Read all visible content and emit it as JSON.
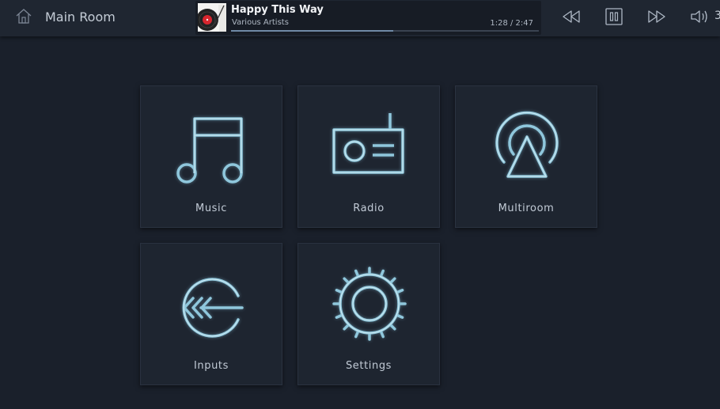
{
  "header": {
    "room_title": "Main Room",
    "volume": "3"
  },
  "now_playing": {
    "title": "Happy This Way",
    "artist": "Various Artists",
    "time": "1:28 / 2:47",
    "progress": 0.527
  },
  "controls": {
    "icons": [
      "home-icon",
      "rewind-icon",
      "pause-icon",
      "fast-forward-icon",
      "volume-icon"
    ]
  },
  "tiles": [
    {
      "label": "Music",
      "icon": "music-note-icon"
    },
    {
      "label": "Radio",
      "icon": "radio-icon"
    },
    {
      "label": "Multiroom",
      "icon": "multiroom-icon"
    },
    {
      "label": "Inputs",
      "icon": "inputs-icon"
    },
    {
      "label": "Settings",
      "icon": "gear-icon"
    }
  ],
  "colors": {
    "background": "#1a202b",
    "tile": "#1e2530",
    "icon_stroke": "#8fc7dc",
    "icon_highlight": "#d6eef6",
    "progress": "#6f8aa6"
  }
}
